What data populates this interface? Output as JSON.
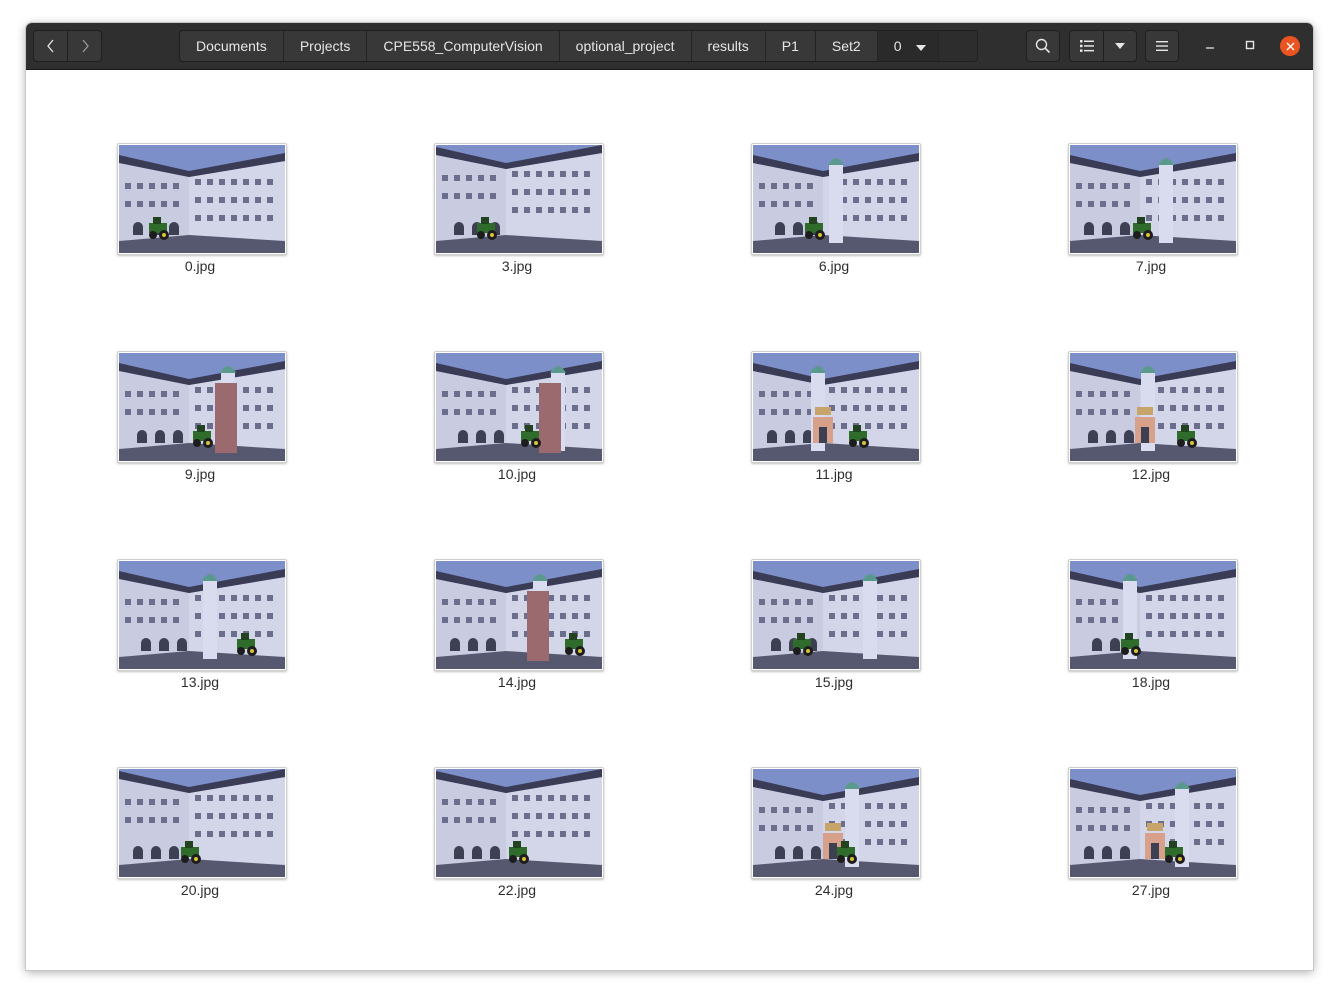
{
  "headerbar": {
    "back_icon": "chevron-left-icon",
    "forward_icon": "chevron-right-icon",
    "breadcrumbs": [
      "Documents",
      "Projects",
      "CPE558_ComputerVision",
      "optional_project",
      "results",
      "P1",
      "Set2",
      "0"
    ],
    "search_icon": "search-icon",
    "view_icon": "list-view-icon",
    "view_options_icon": "caret-down-icon",
    "menu_icon": "hamburger-menu-icon",
    "window_controls": [
      "minimize-icon",
      "maximize-icon",
      "close-icon"
    ],
    "close_color": "#e95420"
  },
  "files": [
    {
      "name": "0.jpg",
      "scene": "right"
    },
    {
      "name": "3.jpg",
      "scene": "flat"
    },
    {
      "name": "6.jpg",
      "scene": "corner"
    },
    {
      "name": "7.jpg",
      "scene": "corner"
    },
    {
      "name": "9.jpg",
      "scene": "red"
    },
    {
      "name": "10.jpg",
      "scene": "red"
    },
    {
      "name": "11.jpg",
      "scene": "portal"
    },
    {
      "name": "12.jpg",
      "scene": "portal"
    },
    {
      "name": "13.jpg",
      "scene": "corner"
    },
    {
      "name": "14.jpg",
      "scene": "red"
    },
    {
      "name": "15.jpg",
      "scene": "corner"
    },
    {
      "name": "18.jpg",
      "scene": "corner"
    },
    {
      "name": "20.jpg",
      "scene": "flat"
    },
    {
      "name": "22.jpg",
      "scene": "flat"
    },
    {
      "name": "24.jpg",
      "scene": "portal"
    },
    {
      "name": "27.jpg",
      "scene": "portal"
    }
  ],
  "colors": {
    "headerbar": "#2f2f2f",
    "sky": "#7d8fc9",
    "wall": "#c9cbe0",
    "roof": "#3a3b55",
    "ground": "#565870",
    "tractor": "#2f6b2a"
  }
}
